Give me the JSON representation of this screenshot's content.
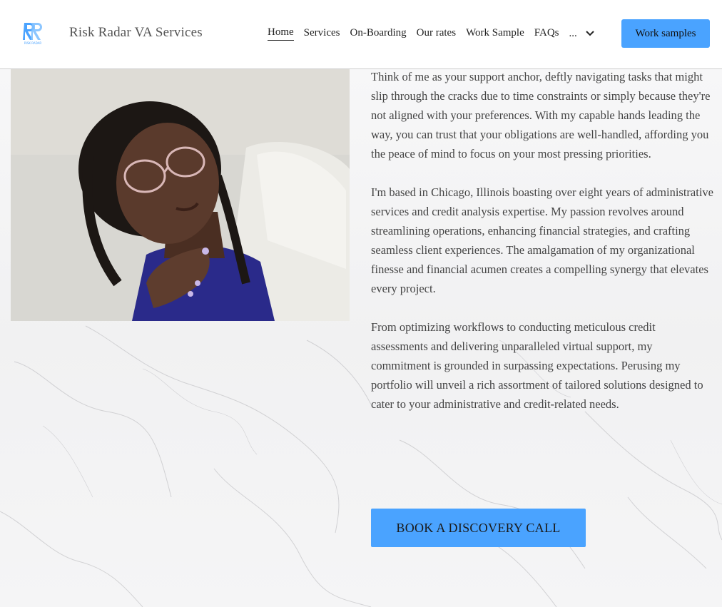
{
  "header": {
    "brand": "Risk Radar VA Services",
    "logo_text": "RISK RADAR",
    "nav": [
      {
        "label": "Home",
        "active": true
      },
      {
        "label": "Services"
      },
      {
        "label": "On-Boarding"
      },
      {
        "label": "Our rates"
      },
      {
        "label": "Work Sample"
      },
      {
        "label": "FAQs"
      }
    ],
    "more_label": "...",
    "cta_label": "Work samples"
  },
  "main": {
    "paragraphs": [
      "Think of me as your support anchor, deftly navigating tasks that might slip through the cracks due to time constraints or simply because they're not aligned with your preferences. With my capable hands leading the way, you can trust that your obligations are well-handled, affording you the peace of mind to focus on your most pressing priorities.",
      "I'm based in Chicago, Illinois boasting over eight years of administrative services and credit analysis expertise. My passion revolves around streamlining operations, enhancing financial strategies, and crafting seamless client experiences. The amalgamation of my organizational finesse and financial acumen creates a compelling synergy that elevates every project.",
      "From optimizing workflows to conducting meticulous credit assessments and delivering unparalleled virtual support, my commitment is grounded in surpassing expectations. Perusing my portfolio will unveil a rich assortment of tailored solutions designed to cater to your administrative and credit-related needs."
    ],
    "book_button": "BOOK A DISCOVERY CALL"
  },
  "colors": {
    "accent": "#4aa3ff",
    "header_bg": "#ffffff",
    "text": "#444444"
  }
}
